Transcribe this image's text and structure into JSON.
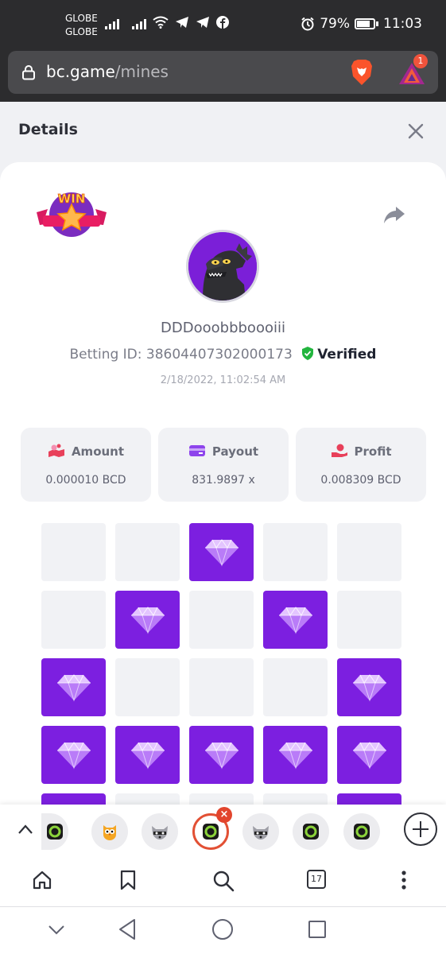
{
  "status_bar": {
    "carrier_line1": "GLOBE",
    "carrier_line2": "GLOBE",
    "icons": [
      "signal-icon",
      "signal-icon",
      "wifi-icon",
      "telegram-icon",
      "telegram-icon",
      "facebook-icon"
    ],
    "battery": "79%",
    "time": "11:03"
  },
  "browser": {
    "url_domain": "bc.game",
    "url_path": "/mines",
    "rewards_count": "1",
    "open_tab_count": "17"
  },
  "details": {
    "title": "Details",
    "username": "DDDooobbboooiii",
    "betting_id_label": "Betting ID: 38604407302000173",
    "verified_label": "Verified",
    "timestamp": "2/18/2022, 11:02:54 AM",
    "stats": [
      {
        "label": "Amount",
        "value": "0.000010 BCD"
      },
      {
        "label": "Payout",
        "value": "831.9897 x"
      },
      {
        "label": "Profit",
        "value": "0.008309 BCD"
      }
    ],
    "win_badge_text": "WIN"
  },
  "mines_grid": {
    "rows": [
      [
        0,
        0,
        1,
        0,
        0
      ],
      [
        0,
        1,
        0,
        1,
        0
      ],
      [
        1,
        0,
        0,
        0,
        1
      ],
      [
        1,
        1,
        1,
        1,
        1
      ],
      [
        1,
        0,
        0,
        0,
        1
      ]
    ]
  },
  "colors": {
    "gem_tile": "#7c1fe0",
    "empty_tile": "#f1f2f5",
    "verified_green": "#22b53e",
    "tab_active_ring": "#e25034"
  }
}
